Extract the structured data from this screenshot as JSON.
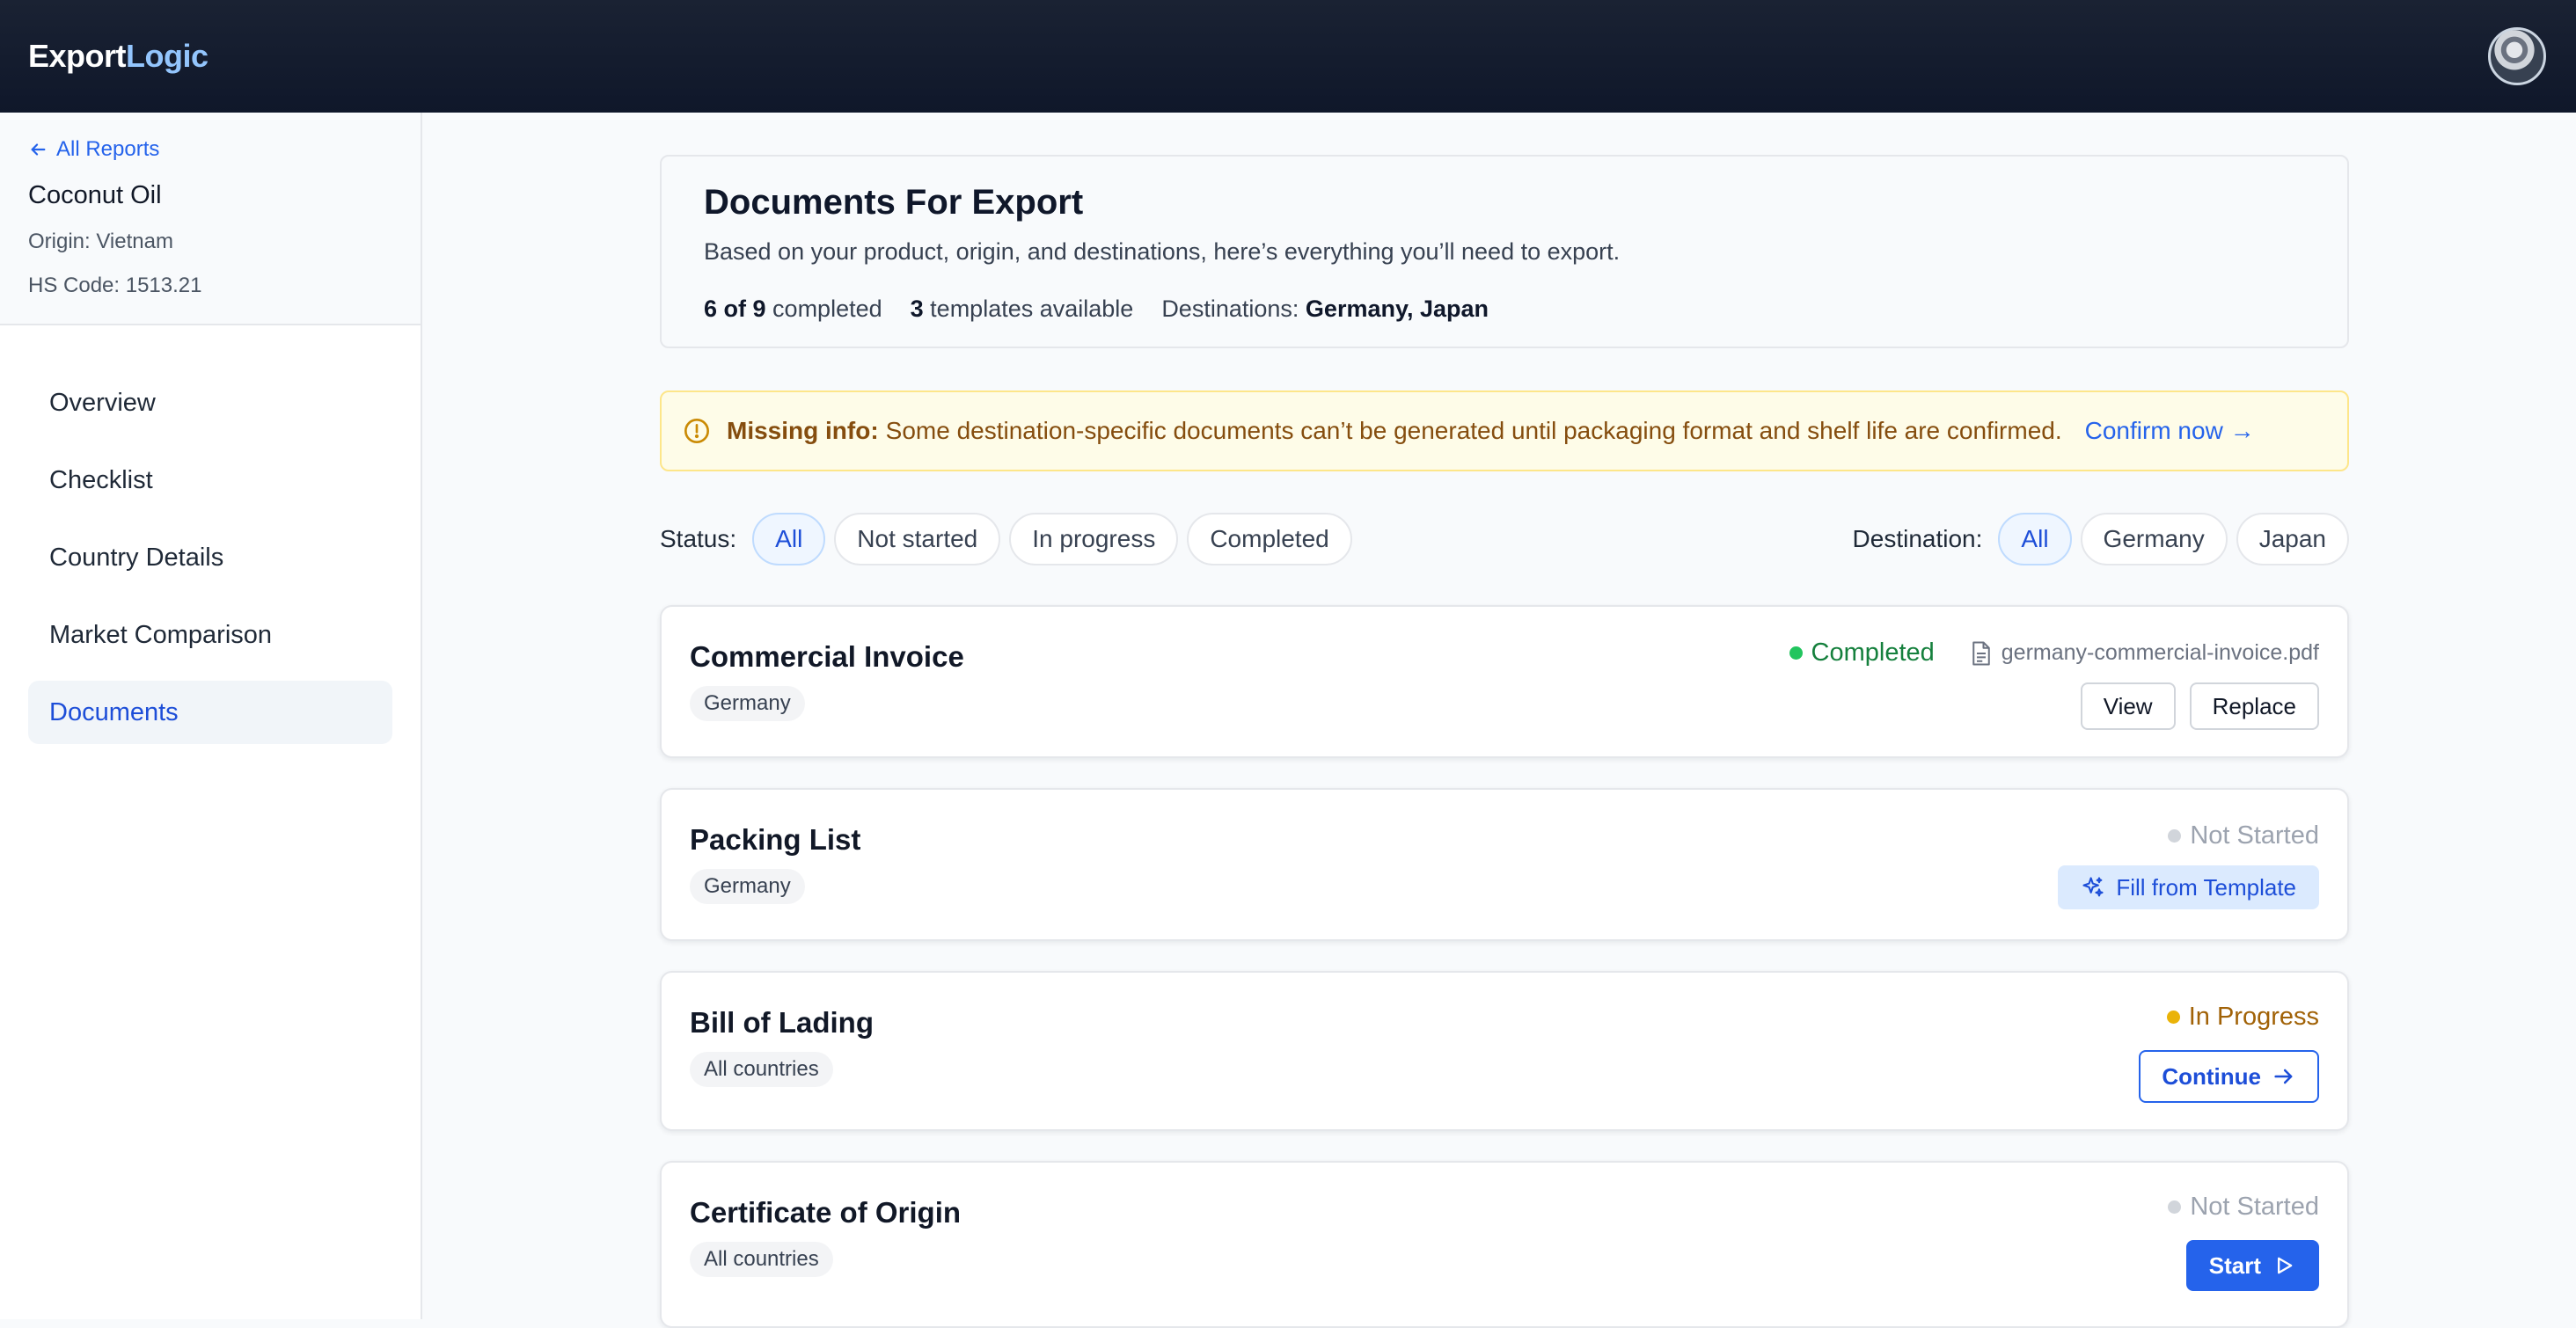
{
  "app": {
    "logo_a": "Export",
    "logo_b": "Logic"
  },
  "sidebar": {
    "back_label": "All Reports",
    "product": "Coconut Oil",
    "origin": "Origin: Vietnam",
    "hs_code": "HS Code: 1513.21",
    "items": [
      {
        "label": "Overview",
        "active": false
      },
      {
        "label": "Checklist",
        "active": false
      },
      {
        "label": "Country Details",
        "active": false
      },
      {
        "label": "Market Comparison",
        "active": false
      },
      {
        "label": "Documents",
        "active": true
      }
    ]
  },
  "summary": {
    "title": "Documents For Export",
    "subtitle": "Based on your product, origin, and destinations, here’s everything you’ll need to export.",
    "completed_count": "6 of 9",
    "completed_label": "completed",
    "templates_count": "3",
    "templates_label": "templates available",
    "destinations_label": "Destinations:",
    "destinations_value": "Germany, Japan"
  },
  "alert": {
    "title": "Missing info:",
    "message": "Some destination-specific documents can’t be generated until packaging format and shelf life are confirmed.",
    "link": "Confirm now →",
    "color": "#854d0e"
  },
  "filters": {
    "status_label": "Status:",
    "status_options": [
      "All",
      "Not started",
      "In progress",
      "Completed"
    ],
    "destination_label": "Destination:",
    "destination_options": [
      "All",
      "Germany",
      "Japan"
    ]
  },
  "documents": [
    {
      "title": "Commercial Invoice",
      "tag": "Germany",
      "status": "Completed",
      "status_color": "#15803d",
      "dot_color": "#22c55e",
      "file": "germany-commercial-invoice.pdf",
      "actions": [
        "View",
        "Replace"
      ]
    },
    {
      "title": "Packing List",
      "tag": "Germany",
      "status": "Not Started",
      "status_color": "#9ca3af",
      "dot_color": "#d1d5db",
      "action": "Fill from Template"
    },
    {
      "title": "Bill of Lading",
      "tag": "All countries",
      "status": "In Progress",
      "status_color": "#a16207",
      "dot_color": "#eab308",
      "action": "Continue"
    },
    {
      "title": "Certificate of Origin",
      "tag": "All countries",
      "status": "Not Started",
      "status_color": "#9ca3af",
      "dot_color": "#d1d5db",
      "action": "Start"
    }
  ]
}
